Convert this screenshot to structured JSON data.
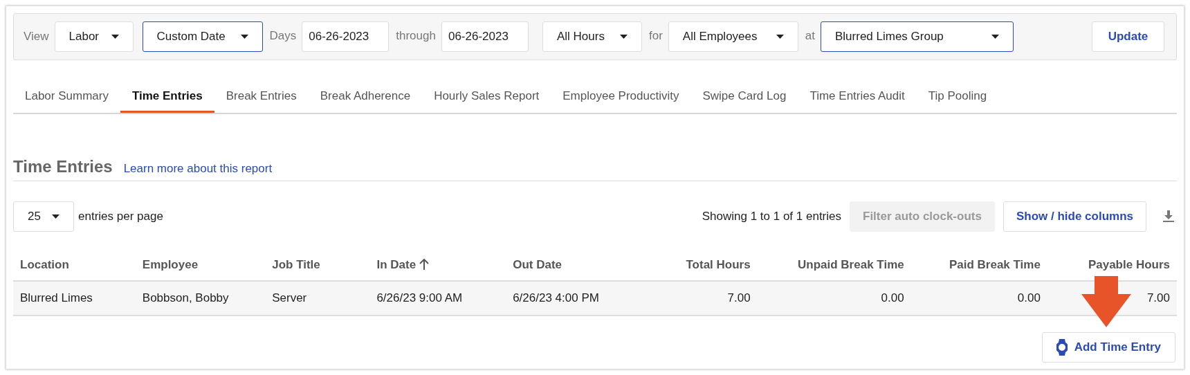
{
  "filters": [
    {
      "kind": "label",
      "text": "View"
    },
    {
      "kind": "select",
      "value": "Labor",
      "focused": false
    },
    {
      "kind": "select",
      "value": "Custom Date",
      "focused": true
    },
    {
      "kind": "label",
      "text": "Days"
    },
    {
      "kind": "input",
      "value": "06-26-2023"
    },
    {
      "kind": "label",
      "text": "through"
    },
    {
      "kind": "input",
      "value": "06-26-2023"
    },
    {
      "kind": "select",
      "value": "All Hours",
      "focused": false
    },
    {
      "kind": "label",
      "text": "for"
    },
    {
      "kind": "select",
      "value": "All Employees",
      "focused": false
    },
    {
      "kind": "label",
      "text": "at"
    },
    {
      "kind": "select",
      "value": "Blurred Limes Group",
      "focused": true
    }
  ],
  "update_button": "Update",
  "tabs": [
    {
      "label": "Labor Summary",
      "selected": false
    },
    {
      "label": "Time Entries",
      "selected": true
    },
    {
      "label": "Break Entries",
      "selected": false
    },
    {
      "label": "Break Adherence",
      "selected": false
    },
    {
      "label": "Hourly Sales Report",
      "selected": false
    },
    {
      "label": "Employee Productivity",
      "selected": false
    },
    {
      "label": "Swipe Card Log",
      "selected": false
    },
    {
      "label": "Time Entries Audit",
      "selected": false
    },
    {
      "label": "Tip Pooling",
      "selected": false
    }
  ],
  "report": {
    "title": "Time Entries",
    "link": "Learn more about this report",
    "page_size": "25",
    "page_size_label": "entries per page",
    "showing": "Showing 1 to 1 of 1 entries",
    "buttons": [
      {
        "label": "Filter auto clock-outs",
        "disabled": true
      },
      {
        "label": "Show / hide columns",
        "disabled": false
      }
    ],
    "columns": [
      {
        "label": "Location",
        "numeric": false,
        "sorted": false
      },
      {
        "label": "Employee",
        "numeric": false,
        "sorted": false
      },
      {
        "label": "Job Title",
        "numeric": false,
        "sorted": false
      },
      {
        "label": "In Date",
        "numeric": false,
        "sorted": true
      },
      {
        "label": "Out Date",
        "numeric": false,
        "sorted": false
      },
      {
        "label": "Total Hours",
        "numeric": true,
        "sorted": false
      },
      {
        "label": "Unpaid Break Time",
        "numeric": true,
        "sorted": false
      },
      {
        "label": "Paid Break Time",
        "numeric": true,
        "sorted": false
      },
      {
        "label": "Payable Hours",
        "numeric": true,
        "sorted": false
      }
    ],
    "rows": [
      [
        "Blurred Limes",
        "Bobbson, Bobby",
        "Server",
        "6/26/23 9:00 AM",
        "6/26/23 4:00 PM",
        "7.00",
        "0.00",
        "0.00",
        "7.00"
      ]
    ],
    "add_button": "Add Time Entry"
  }
}
